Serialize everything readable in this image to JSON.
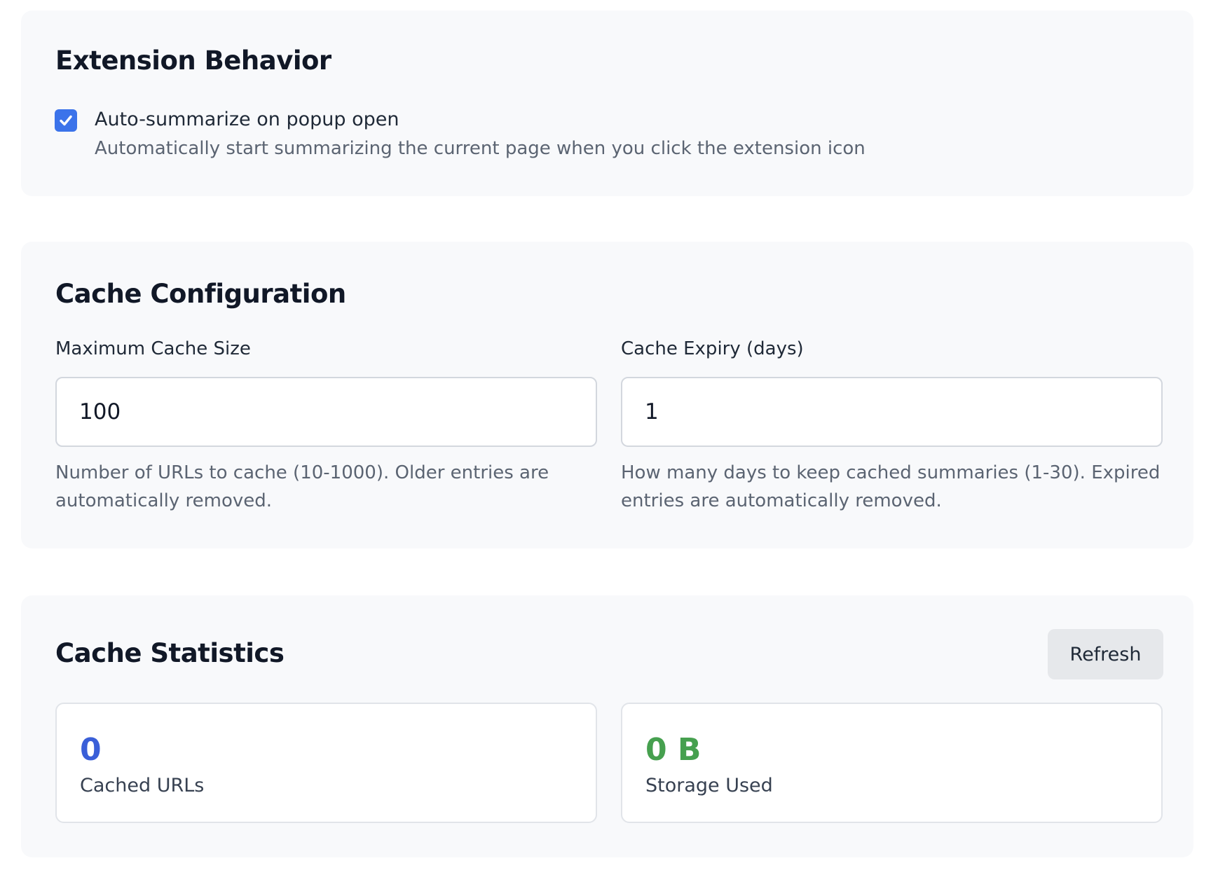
{
  "behavior": {
    "title": "Extension Behavior",
    "auto_summarize": {
      "checked": true,
      "label": "Auto-summarize on popup open",
      "description": "Automatically start summarizing the current page when you click the extension icon"
    }
  },
  "cache_config": {
    "title": "Cache Configuration",
    "max_size": {
      "label": "Maximum Cache Size",
      "value": "100",
      "help": "Number of URLs to cache (10-1000). Older entries are automatically removed."
    },
    "expiry": {
      "label": "Cache Expiry (days)",
      "value": "1",
      "help": "How many days to keep cached summaries (1-30). Expired entries are automatically removed."
    }
  },
  "cache_stats": {
    "title": "Cache Statistics",
    "refresh_label": "Refresh",
    "cached_urls": {
      "value": "0",
      "label": "Cached URLs",
      "color": "#3a5fd8"
    },
    "storage_used": {
      "value": "0 B",
      "label": "Storage Used",
      "color": "#46a04f"
    }
  },
  "colors": {
    "accent": "#3b73ea",
    "section_bg": "#f8f9fb"
  },
  "icons": {
    "checkbox": "checkmark-icon"
  }
}
